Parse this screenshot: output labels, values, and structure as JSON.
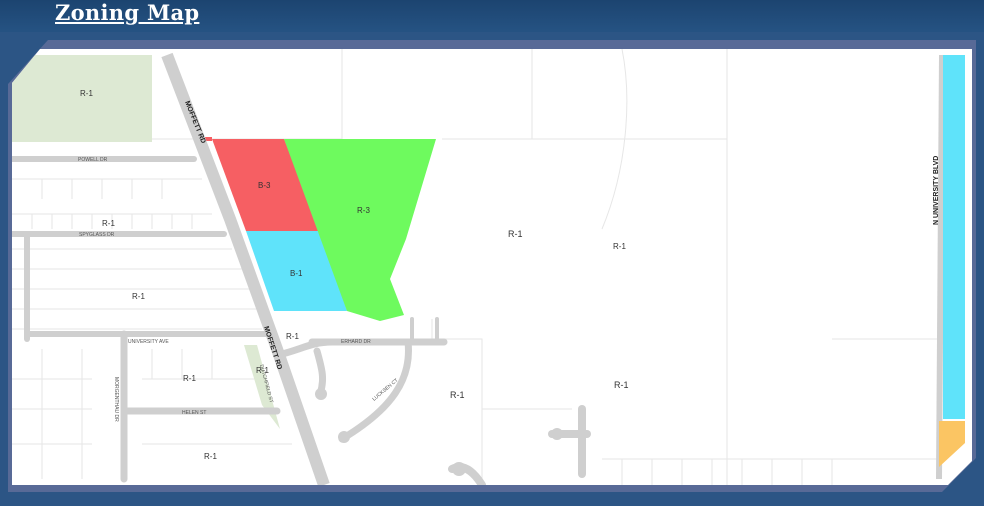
{
  "title": "Zoning Map",
  "colors": {
    "B-3": "#f65f63",
    "R-3": "#6efa5e",
    "B-1": "#5fe3fa",
    "R-1_park": "#dde9d3",
    "corridor_blue": "#5fe3fa",
    "corridor_orange": "#fbc563",
    "road": "#cfcfcf",
    "parcel_line": "#e5e5e5"
  },
  "roads": {
    "moffett_north": "MOFFETT RD",
    "moffett_south": "MOFFETT RD",
    "university_blvd": "N UNIVERSITY BLVD",
    "powell": "POWELL DR",
    "spyglass": "SPYGLASS DR",
    "university_ave": "UNIVERSITY AVE",
    "erhard": "ERHARD DR",
    "helen": "HELEN ST",
    "lucksen": "LUCKSEN CT",
    "morgenthau": "MORGENTHAU DR",
    "dutchfield": "DUTCHFIELD ST"
  },
  "zones": {
    "b3": "B-3",
    "r3": "R-3",
    "b1": "B-1",
    "r1": "R-1"
  }
}
